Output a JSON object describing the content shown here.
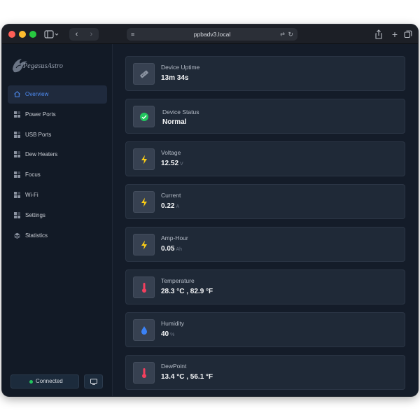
{
  "browser": {
    "url": "ppbadv3.local",
    "tab_icon_glyph": "≡",
    "translate_glyph": "⇄",
    "reload_glyph": "↻",
    "back_glyph": "‹",
    "forward_glyph": "›",
    "plus_glyph": "+"
  },
  "sidebar": {
    "logo_text": "PegasusAstro",
    "items": [
      {
        "label": "Overview",
        "icon": "home-icon",
        "active": true
      },
      {
        "label": "Power Ports",
        "icon": "grid-icon",
        "active": false
      },
      {
        "label": "USB Ports",
        "icon": "grid-icon",
        "active": false
      },
      {
        "label": "Dew Heaters",
        "icon": "grid-icon",
        "active": false
      },
      {
        "label": "Focus",
        "icon": "grid-icon",
        "active": false
      },
      {
        "label": "Wi-Fi",
        "icon": "grid-icon",
        "active": false
      },
      {
        "label": "Settings",
        "icon": "grid-icon",
        "active": false
      },
      {
        "label": "Statistics",
        "icon": "layers-icon",
        "active": false
      }
    ],
    "connection_label": "Connected",
    "monitor_icon": "monitor-icon"
  },
  "cards": [
    {
      "label": "Device Uptime",
      "value": "13m 34s",
      "unit": "",
      "icon": "uptime-icon"
    },
    {
      "label": "Device Status",
      "value": "Normal",
      "unit": "",
      "icon": "check-icon"
    },
    {
      "label": "Voltage",
      "value": "12.52",
      "unit": "V",
      "icon": "bolt-icon"
    },
    {
      "label": "Current",
      "value": "0.22",
      "unit": "A",
      "icon": "bolt-icon"
    },
    {
      "label": "Amp-Hour",
      "value": "0.05",
      "unit": "Ah",
      "icon": "bolt-icon"
    },
    {
      "label": "Temperature",
      "value": "28.3 °C , 82.9 °F",
      "unit": "",
      "icon": "thermometer-icon"
    },
    {
      "label": "Humidity",
      "value": "40",
      "unit": "%",
      "icon": "droplet-icon"
    },
    {
      "label": "DewPoint",
      "value": "13.4 °C , 56.1 °F",
      "unit": "",
      "icon": "thermometer-icon"
    }
  ],
  "colors": {
    "accent": "#4f8df5",
    "bolt": "#facc15",
    "check": "#22c55e",
    "thermo": "#f43f5e",
    "droplet": "#3b82f6"
  }
}
